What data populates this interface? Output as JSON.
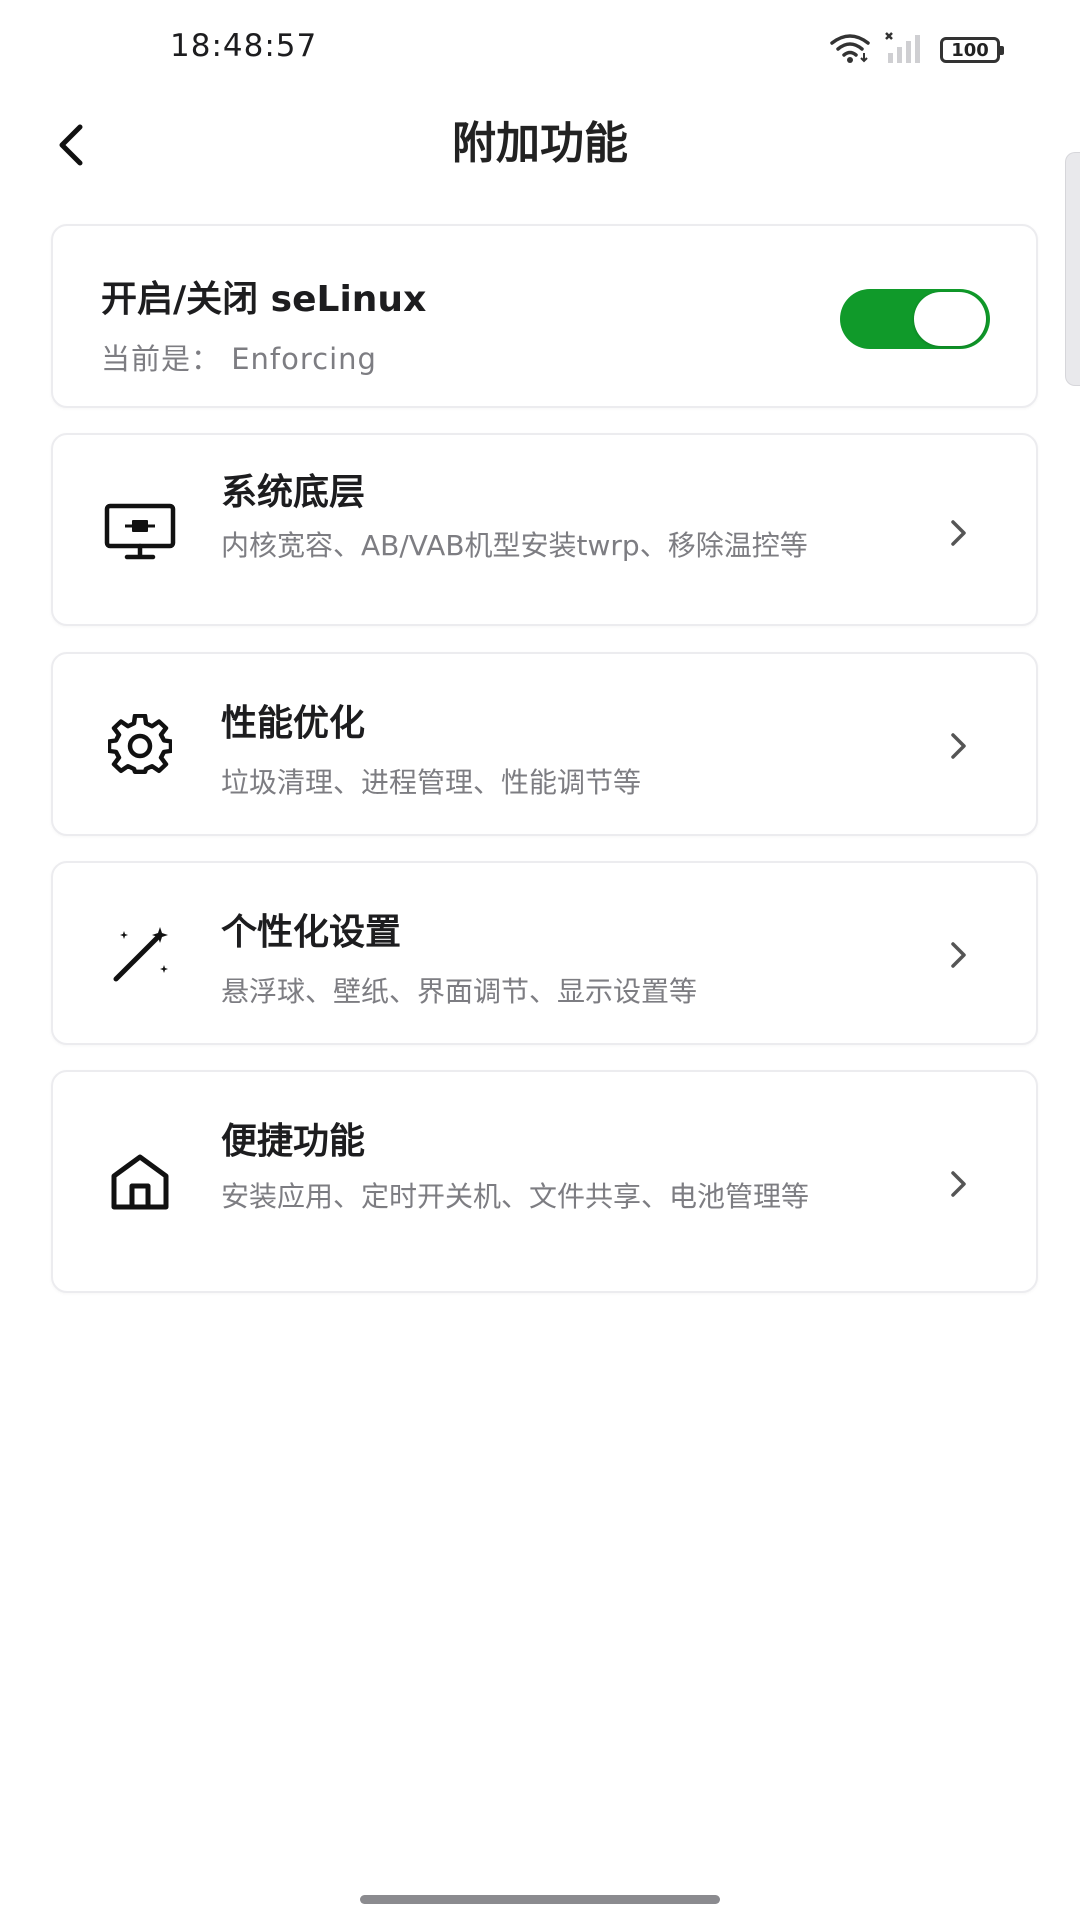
{
  "status_bar": {
    "time": "18:48:57",
    "battery": "100",
    "icons": [
      "wifi-icon",
      "signal-icon",
      "battery-icon"
    ]
  },
  "header": {
    "back_icon": "back-arrow-icon",
    "title": "附加功能"
  },
  "selinux": {
    "title": "开启/关闭 seLinux",
    "status": "当前是：  Enforcing",
    "enabled": true
  },
  "items": [
    {
      "icon": "monitor-icon",
      "title": "系统底层",
      "desc": "内核宽容、AB/VAB机型安装twrp、移除温控等"
    },
    {
      "icon": "gear-icon",
      "title": "性能优化",
      "desc": "垃圾清理、进程管理、性能调节等"
    },
    {
      "icon": "magic-wand-icon",
      "title": "个性化设置",
      "desc": "悬浮球、壁纸、界面调节、显示设置等"
    },
    {
      "icon": "home-icon",
      "title": "便捷功能",
      "desc": "安装应用、定时开关机、文件共享、电池管理等"
    }
  ],
  "colors": {
    "toggle_on": "#109a2a",
    "text_primary": "#1d1d1f",
    "text_secondary": "#7d7d82",
    "card_border": "#ececef"
  }
}
